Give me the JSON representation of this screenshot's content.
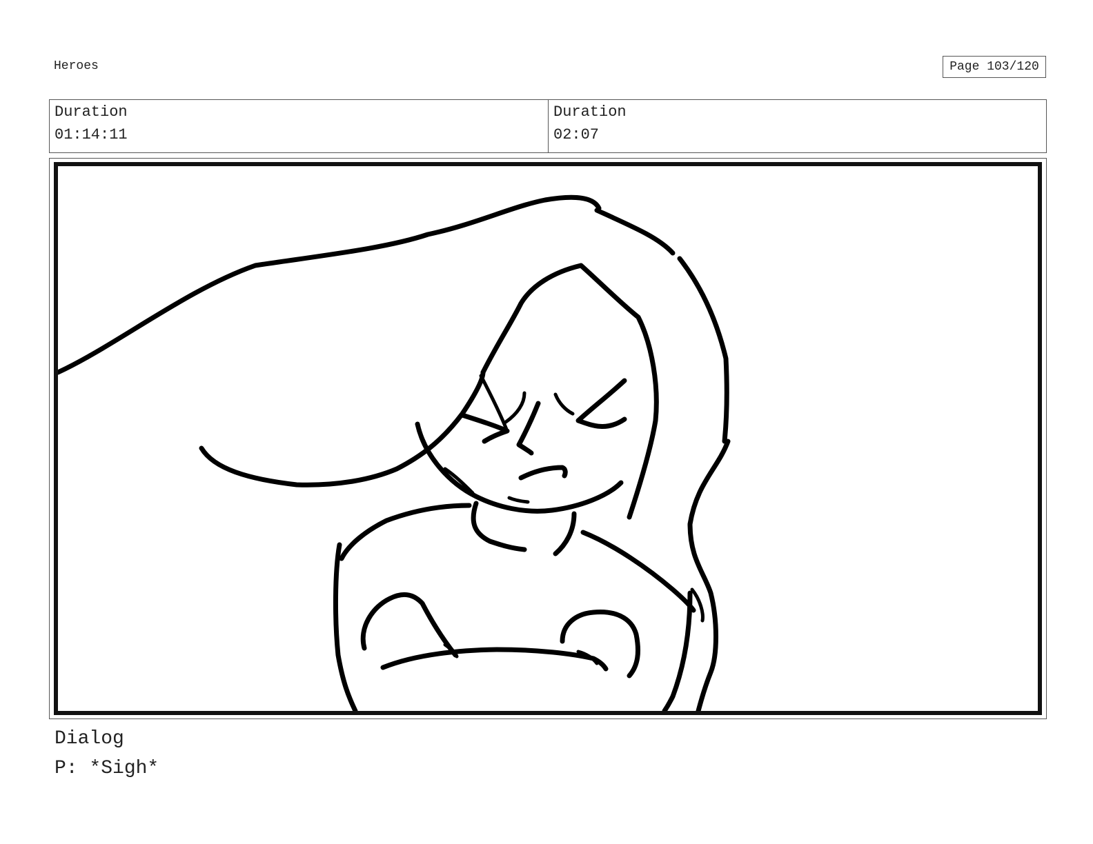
{
  "header": {
    "title": "Heroes",
    "page_label": "Page 103/120"
  },
  "durations": [
    {
      "label": "Duration",
      "value": "01:14:11"
    },
    {
      "label": "Duration",
      "value": "02:07"
    }
  ],
  "panel": {
    "drawing_icon": "storyboard-sketch"
  },
  "dialog": {
    "label": "Dialog",
    "text": "P: *Sigh*"
  }
}
